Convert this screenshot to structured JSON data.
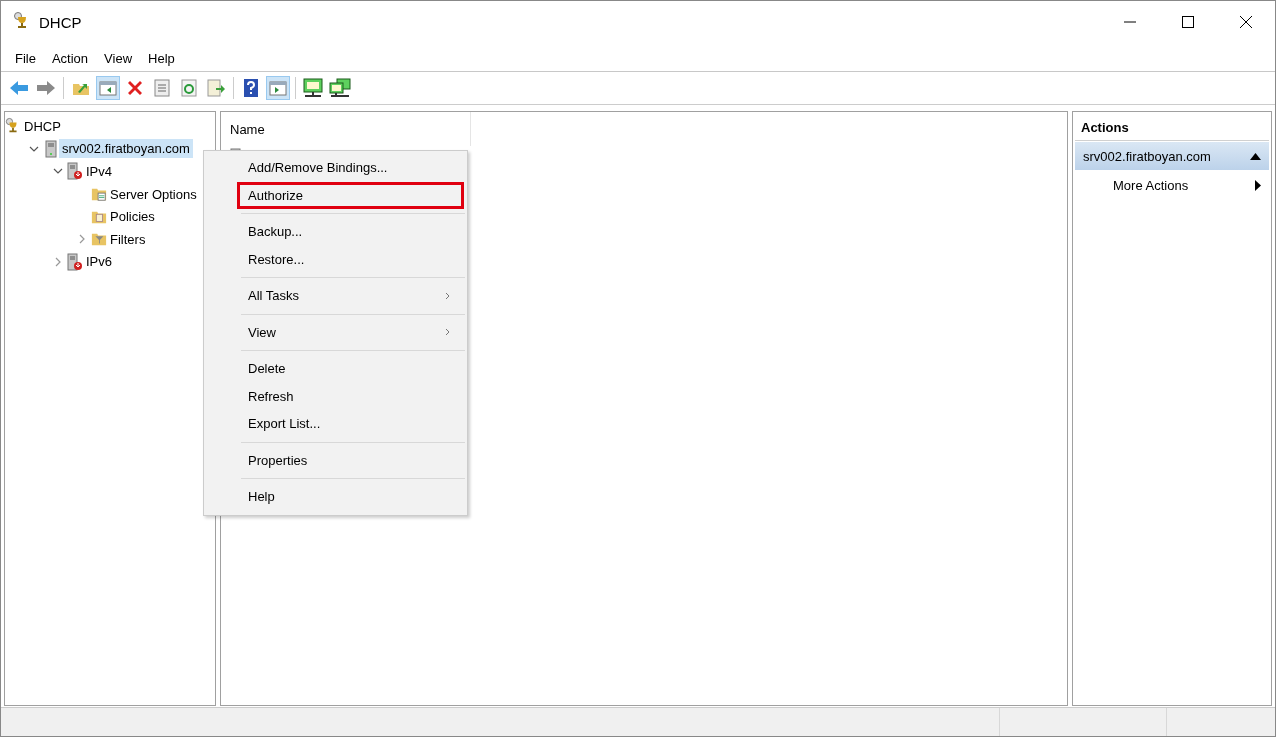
{
  "window": {
    "title": "DHCP"
  },
  "menubar": [
    "File",
    "Action",
    "View",
    "Help"
  ],
  "toolbar": [
    [
      {
        "kind": "back",
        "on": false
      },
      {
        "kind": "forward",
        "on": false
      }
    ],
    [
      {
        "kind": "up",
        "on": false
      },
      {
        "kind": "tree-pane",
        "on": true
      },
      {
        "kind": "delete",
        "on": false
      },
      {
        "kind": "properties",
        "on": false
      },
      {
        "kind": "refresh",
        "on": false
      },
      {
        "kind": "export",
        "on": false
      }
    ],
    [
      {
        "kind": "help",
        "on": false
      },
      {
        "kind": "action-pane",
        "on": true
      }
    ],
    [
      {
        "kind": "monitor",
        "on": false
      },
      {
        "kind": "monitors",
        "on": false
      }
    ]
  ],
  "tree": [
    {
      "label": "DHCP",
      "kind": "dhcp",
      "selected": false,
      "children": [
        {
          "label": "srv002.firatboyan.com",
          "kind": "server",
          "selected": true,
          "expanded": true,
          "children": [
            {
              "label": "IPv4",
              "kind": "ip",
              "selected": false,
              "expanded": true,
              "children": [
                {
                  "label": "Server Options",
                  "kind": "options",
                  "selected": false
                },
                {
                  "label": "Policies",
                  "kind": "policies",
                  "selected": false
                },
                {
                  "label": "Filters",
                  "kind": "filter",
                  "selected": false,
                  "expanded": false
                }
              ]
            },
            {
              "label": "IPv6",
              "kind": "ip",
              "selected": false,
              "expanded": false
            }
          ]
        }
      ]
    }
  ],
  "list": {
    "columns": [
      "Name"
    ]
  },
  "context_menu": [
    [
      {
        "label": "Add/Remove Bindings...",
        "submenu": false,
        "highlighted": false
      },
      {
        "label": "Authorize",
        "submenu": false,
        "highlighted": true
      }
    ],
    [
      {
        "label": "Backup...",
        "submenu": false,
        "highlighted": false
      },
      {
        "label": "Restore...",
        "submenu": false,
        "highlighted": false
      }
    ],
    [
      {
        "label": "All Tasks",
        "submenu": true,
        "highlighted": false
      }
    ],
    [
      {
        "label": "View",
        "submenu": true,
        "highlighted": false
      }
    ],
    [
      {
        "label": "Delete",
        "submenu": false,
        "highlighted": false
      },
      {
        "label": "Refresh",
        "submenu": false,
        "highlighted": false
      },
      {
        "label": "Export List...",
        "submenu": false,
        "highlighted": false
      }
    ],
    [
      {
        "label": "Properties",
        "submenu": false,
        "highlighted": false
      }
    ],
    [
      {
        "label": "Help",
        "submenu": false,
        "highlighted": false
      }
    ]
  ],
  "actions": {
    "title": "Actions",
    "sections": [
      {
        "title": "srv002.firatboyan.com",
        "expanded": true,
        "items": [
          {
            "label": "More Actions",
            "submenu": true
          }
        ]
      }
    ]
  }
}
